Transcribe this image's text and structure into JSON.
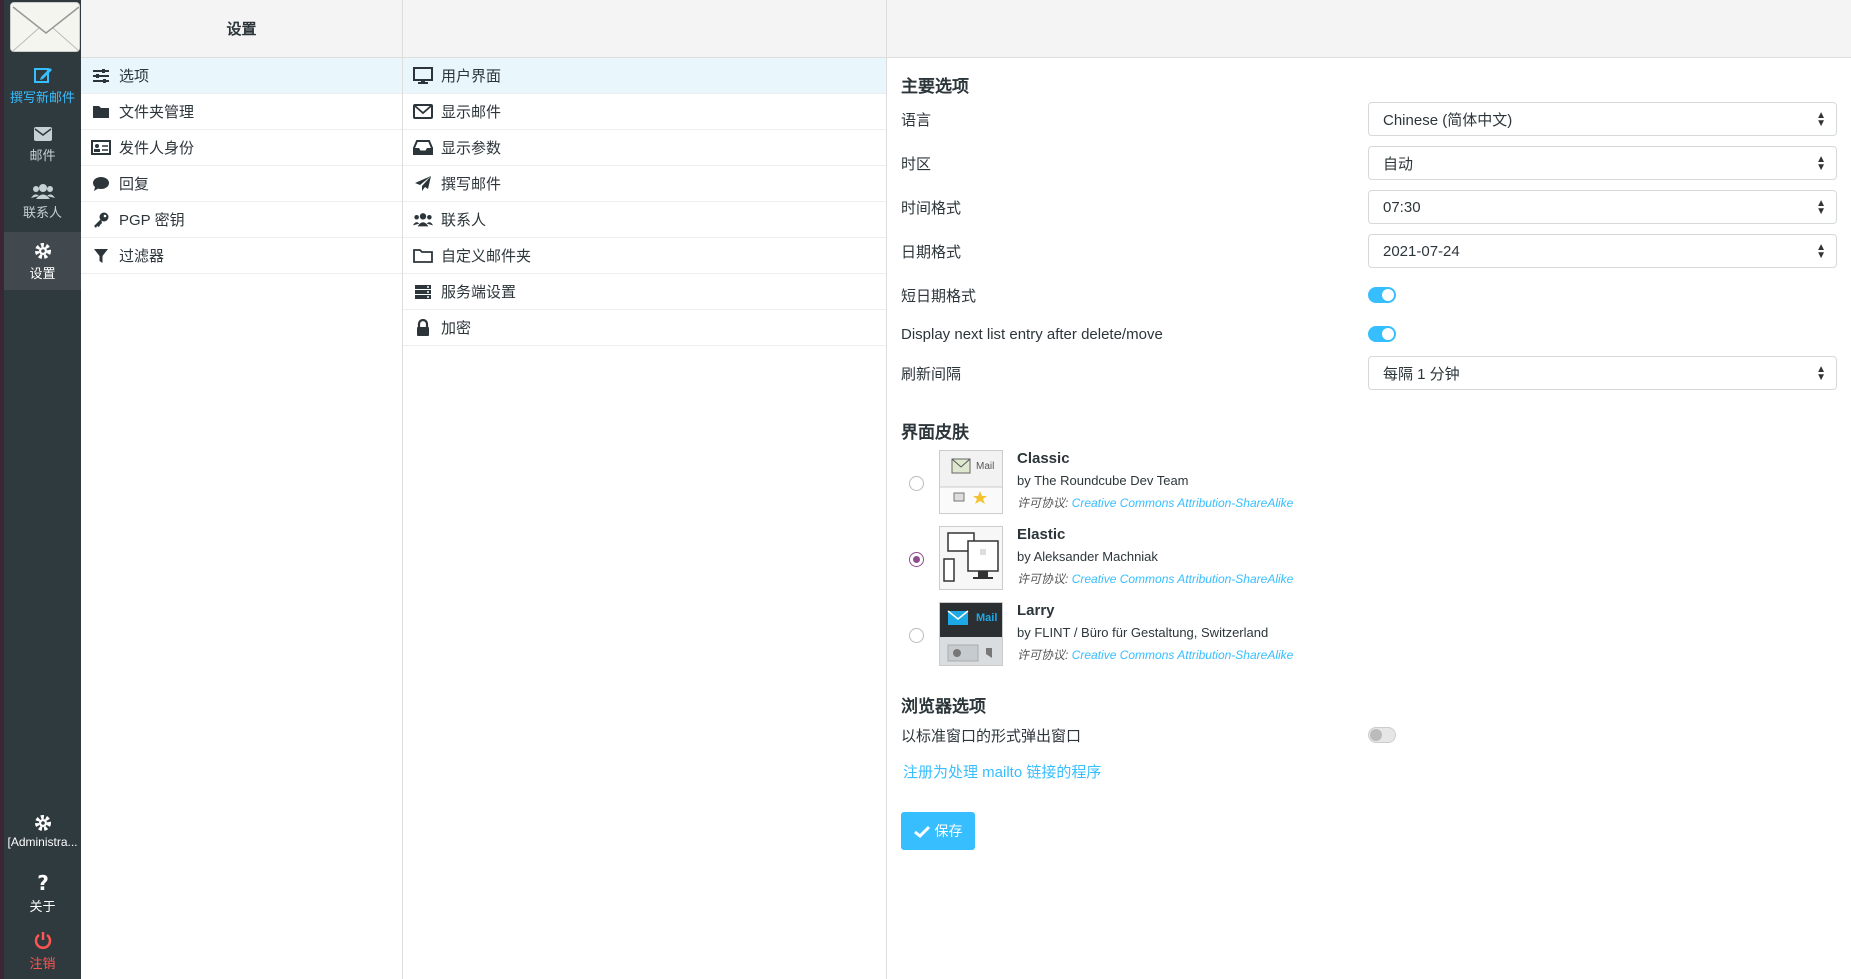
{
  "nav": {
    "compose": "撰写新邮件",
    "mail": "邮件",
    "contacts": "联系人",
    "settings": "设置",
    "admin": "[Administra...",
    "about": "关于",
    "logout": "注销"
  },
  "settings_column": {
    "title": "设置",
    "items": [
      "选项",
      "文件夹管理",
      "发件人身份",
      "回复",
      "PGP 密钥",
      "过滤器"
    ]
  },
  "sections_column": {
    "items": [
      "用户界面",
      "显示邮件",
      "显示参数",
      "撰写邮件",
      "联系人",
      "自定义邮件夹",
      "服务端设置",
      "加密"
    ]
  },
  "main": {
    "main_options_title": "主要选项",
    "language_label": "语言",
    "language_value": "Chinese (简体中文)",
    "timezone_label": "时区",
    "timezone_value": "自动",
    "time_format_label": "时间格式",
    "time_format_value": "07:30",
    "date_format_label": "日期格式",
    "date_format_value": "2021-07-24",
    "short_date_label": "短日期格式",
    "next_entry_label": "Display next list entry after delete/move",
    "refresh_label": "刷新间隔",
    "refresh_value": "每隔 1 分钟",
    "skin_title": "界面皮肤",
    "license_prefix": "许可协议:",
    "skins": [
      {
        "name": "Classic",
        "author": "by The Roundcube Dev Team",
        "license": "Creative Commons Attribution-ShareAlike",
        "thumb_label": "Mail"
      },
      {
        "name": "Elastic",
        "author": "by Aleksander Machniak",
        "license": "Creative Commons Attribution-ShareAlike"
      },
      {
        "name": "Larry",
        "author": "by FLINT / Büro für Gestaltung, Switzerland",
        "license": "Creative Commons Attribution-ShareAlike",
        "thumb_label": "Mail"
      }
    ],
    "browser_title": "浏览器选项",
    "popup_label": "以标准窗口的形式弹出窗口",
    "mailto_link": "注册为处理 mailto 链接的程序",
    "save_label": "保存"
  },
  "colors": {
    "accent": "#37beff",
    "nav_bg": "#2f3a3f",
    "selected_radio": "#8f4d8e",
    "logout": "#ff5552"
  }
}
